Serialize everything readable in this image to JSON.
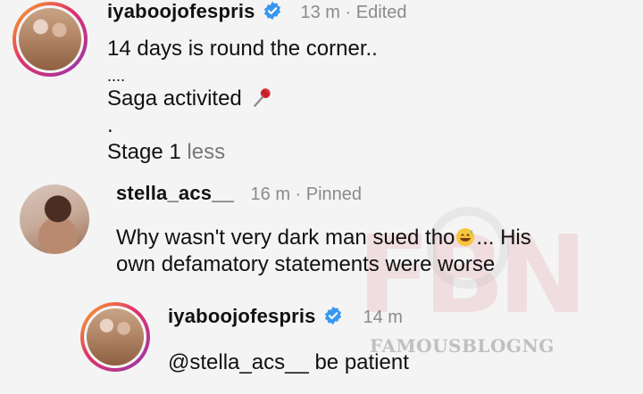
{
  "post": {
    "username": "iyaboojofespris",
    "meta": "13 m · Edited",
    "lines": [
      "14 days is round the corner..",
      "....",
      "Saga activited"
    ],
    "dot": ".",
    "stage_text": "Stage 1 ",
    "less_label": "less"
  },
  "comment": {
    "username": "stella_acs__",
    "meta": "16 m · Pinned",
    "text_line1": "Why wasn't very dark man sued tho",
    "text_line1_end": "... His",
    "text_line2": "own defamatory statements were worse"
  },
  "reply": {
    "username": "iyaboojofespris",
    "meta": "14 m",
    "mention": "@stella_acs__",
    "text": " be patient"
  },
  "watermark": {
    "logo": "FBN",
    "text": "FAMOUSBLOGNG"
  },
  "icons": [
    "verified-badge-icon",
    "pushpin-emoji-icon",
    "grinning-sweat-emoji-icon"
  ],
  "colors": {
    "verified": "#3897f0",
    "meta": "#8a8a8a",
    "avatar_ring": "#e1306c"
  }
}
